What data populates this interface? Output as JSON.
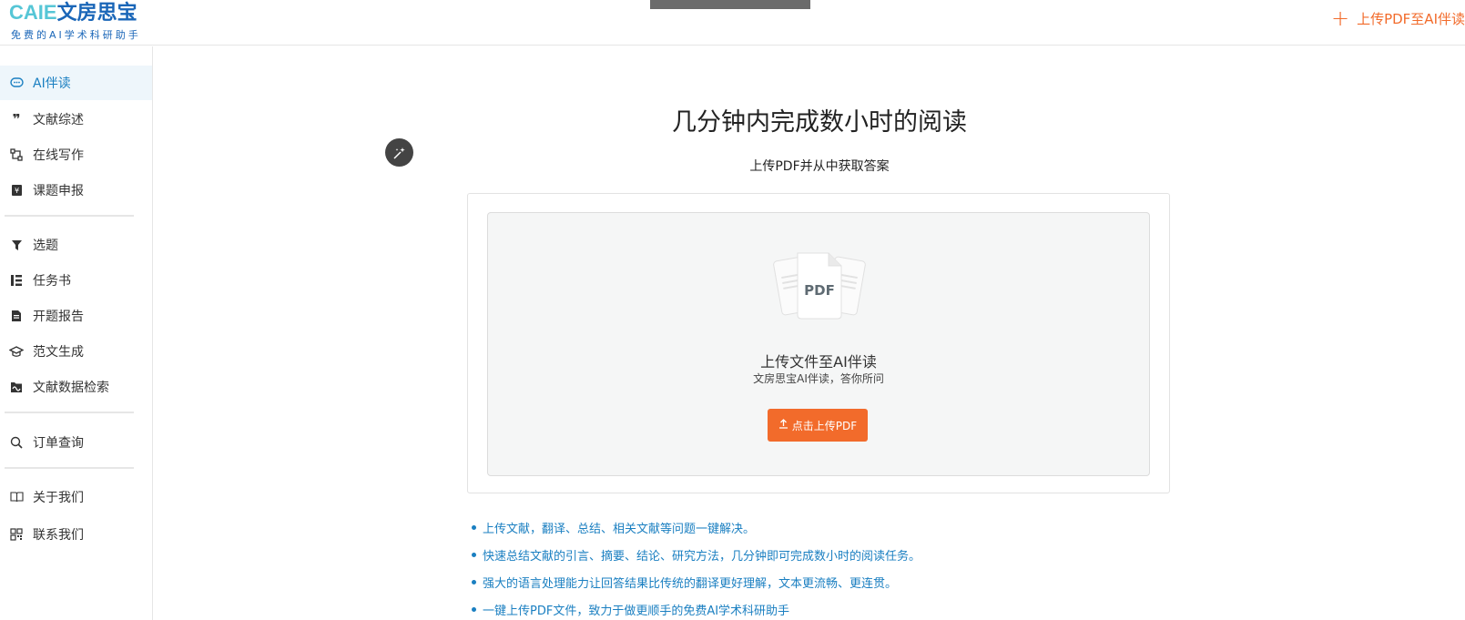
{
  "header": {
    "logo_latin": "CAIE",
    "logo_cjk": "文房思宝",
    "logo_sub": "免费的AI学术科研助手",
    "upload_label": "上传PDF至AI伴读"
  },
  "sidebar": {
    "items": [
      {
        "label": "AI伴读",
        "icon": "chat-bubble-icon",
        "active": true
      },
      {
        "label": "文献综述",
        "icon": "quote-icon"
      },
      {
        "label": "在线写作",
        "icon": "flow-nodes-icon"
      },
      {
        "label": "课题申报",
        "icon": "yen-book-icon"
      },
      {
        "label": "选题",
        "icon": "filter-icon"
      },
      {
        "label": "任务书",
        "icon": "list-tree-icon"
      },
      {
        "label": "开题报告",
        "icon": "document-icon"
      },
      {
        "label": "范文生成",
        "icon": "graduation-cap-icon"
      },
      {
        "label": "文献数据检索",
        "icon": "wave-folder-icon"
      },
      {
        "label": "订单查询",
        "icon": "search-list-icon"
      },
      {
        "label": "关于我们",
        "icon": "open-book-icon"
      },
      {
        "label": "联系我们",
        "icon": "qr-code-icon"
      }
    ]
  },
  "main": {
    "title": "几分钟内完成数小时的阅读",
    "subtitle": "上传PDF并从中获取答案",
    "upload_area": {
      "pdf_label": "PDF",
      "title": "上传文件至AI伴读",
      "subtitle": "文房思宝AI伴读，答你所问",
      "button_label": "点击上传PDF"
    },
    "features": [
      "上传文献，翻译、总结、相关文献等问题一键解决。",
      "快速总结文献的引言、摘要、结论、研究方法，几分钟即可完成数小时的阅读任务。",
      "强大的语言处理能力让回答结果比传统的翻译更好理解，文本更流畅、更连贯。",
      "一键上传PDF文件，致力于做更顺手的免费AI学术科研助手"
    ]
  },
  "colors": {
    "accent_orange": "#f26b2b",
    "accent_blue": "#1a7fc1",
    "logo_cyan": "#56c6d6",
    "logo_blue": "#1a66b8"
  }
}
